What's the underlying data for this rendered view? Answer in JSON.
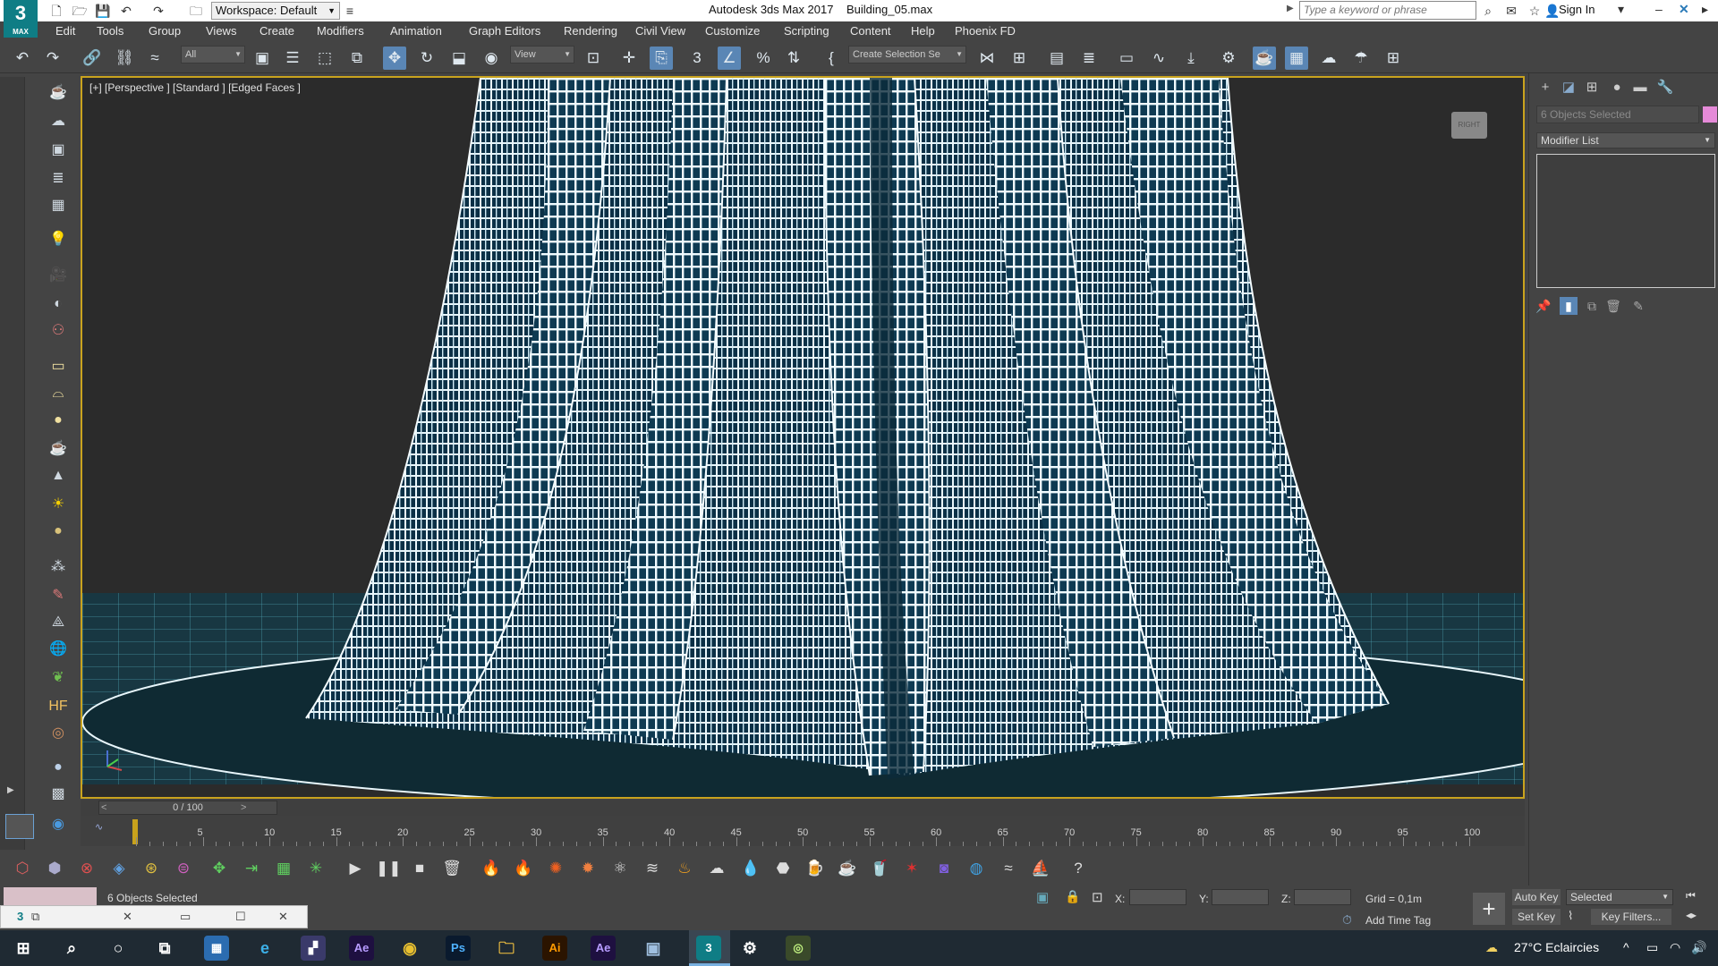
{
  "titlebar": {
    "logo": "3",
    "logo_sub": "MAX",
    "workspace": "Workspace: Default",
    "app_title": "Autodesk 3ds Max 2017",
    "file_title": "Building_05.max",
    "search_placeholder": "Type a keyword or phrase",
    "sign_in": "Sign In"
  },
  "menu": [
    "Edit",
    "Tools",
    "Group",
    "Views",
    "Create",
    "Modifiers",
    "Animation",
    "Graph Editors",
    "Rendering",
    "Civil View",
    "Customize",
    "Scripting",
    "Content",
    "Help",
    "Phoenix FD"
  ],
  "toolbar": {
    "filter_value": "All",
    "coord_value": "View",
    "selection_set": "Create Selection Se"
  },
  "viewport": {
    "label": "[+] [Perspective ] [Standard ] [Edged Faces ]",
    "viewcube": "RIGHT"
  },
  "timeline": {
    "frame_display": "0 / 100",
    "prev": "<",
    "next": ">",
    "ticks": [
      "5",
      "10",
      "15",
      "20",
      "25",
      "30",
      "35",
      "40",
      "45",
      "50",
      "55",
      "60",
      "65",
      "70",
      "75",
      "80",
      "85",
      "90",
      "95",
      "100"
    ]
  },
  "status": {
    "selection_text": "6 Objects Selected",
    "x_label": "X:",
    "y_label": "Y:",
    "z_label": "Z:",
    "grid": "Grid = 0,1m",
    "add_time_tag": "Add Time Tag",
    "auto_key": "Auto Key",
    "set_key": "Set Key",
    "selected": "Selected",
    "key_filters": "Key Filters..."
  },
  "command_panel": {
    "name_field": "6 Objects Selected",
    "modifier_list": "Modifier List",
    "object_color": "#e58ad8"
  },
  "taskbar": {
    "weather": "27°C  Eclaircies"
  },
  "colors": {
    "accent_active": "#5a86b5",
    "viewport_border": "#c9a31e",
    "wireframe": "#e8f6fb",
    "mesh_fill": "#0b3046"
  }
}
